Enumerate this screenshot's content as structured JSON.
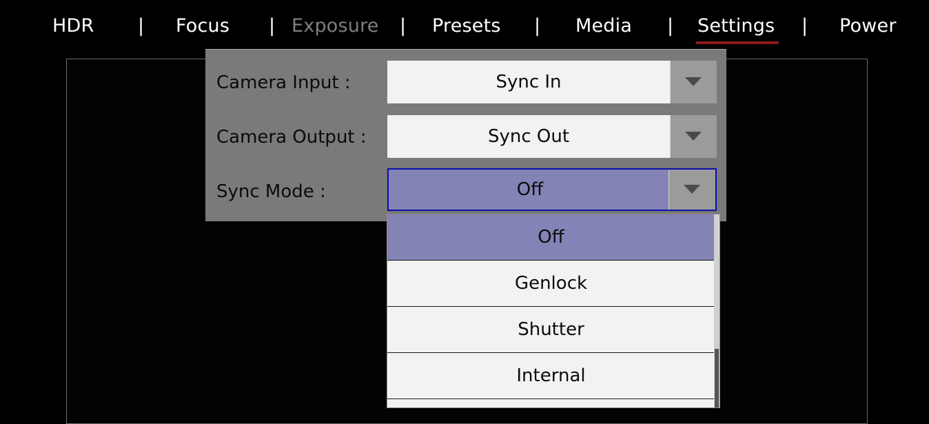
{
  "nav": {
    "tabs": [
      {
        "label": "HDR",
        "state": "normal"
      },
      {
        "label": "Focus",
        "state": "normal"
      },
      {
        "label": "Exposure",
        "state": "disabled"
      },
      {
        "label": "Presets",
        "state": "normal"
      },
      {
        "label": "Media",
        "state": "normal"
      },
      {
        "label": "Settings",
        "state": "active"
      },
      {
        "label": "Power",
        "state": "normal"
      }
    ],
    "separator": "|",
    "active_underline_color": "#8b1d1d"
  },
  "settings": {
    "camera_input": {
      "label": "Camera Input :",
      "value": "Sync In"
    },
    "camera_output": {
      "label": "Camera Output :",
      "value": "Sync Out"
    },
    "sync_mode": {
      "label": "Sync Mode :",
      "value": "Off"
    }
  },
  "dropdown": {
    "options": [
      "Off",
      "Genlock",
      "Shutter",
      "Internal"
    ],
    "selected": "Off",
    "highlight_color": "#8383b6"
  },
  "icons": {
    "dropdown_arrow": "chevron-down-icon"
  }
}
